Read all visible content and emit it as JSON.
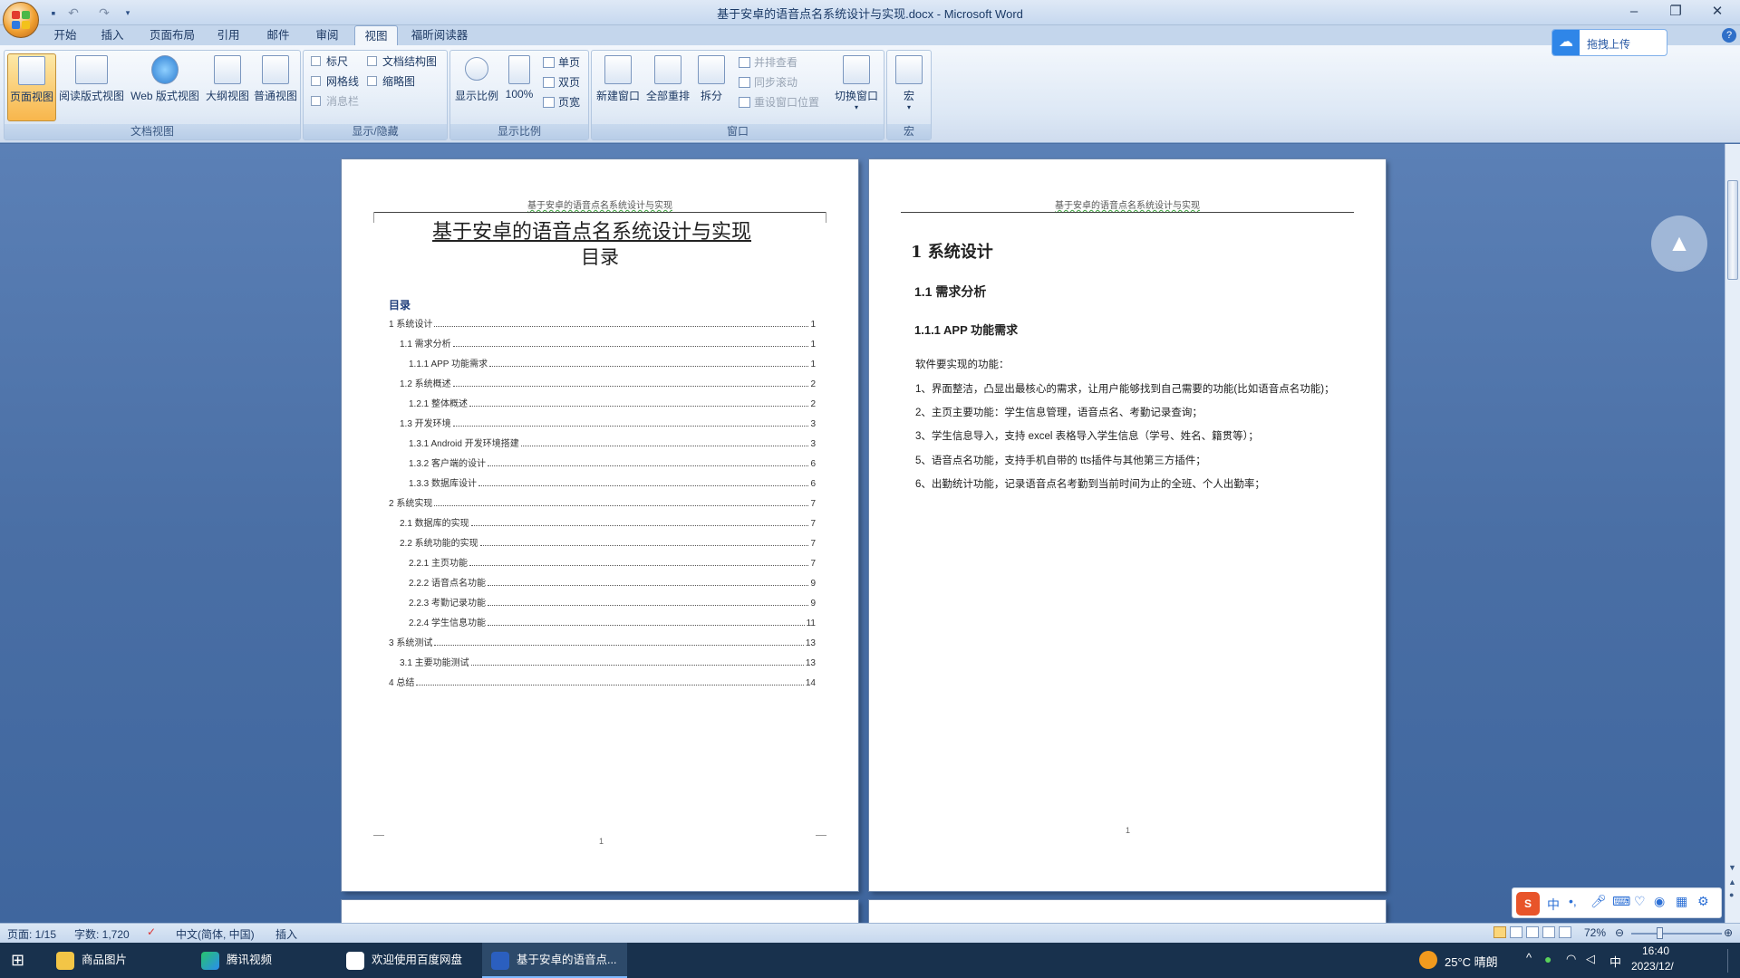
{
  "window": {
    "title": "基于安卓的语音点名系统设计与实现.docx - Microsoft Word"
  },
  "tabs": [
    "开始",
    "插入",
    "页面布局",
    "引用",
    "邮件",
    "审阅",
    "视图",
    "福昕阅读器"
  ],
  "active_tab": "视图",
  "ribbon": {
    "doc_views": {
      "label": "文档视图",
      "buttons": [
        "页面视图",
        "阅读版式视图",
        "Web 版式视图",
        "大纲视图",
        "普通视图"
      ]
    },
    "show_hide": {
      "label": "显示/隐藏",
      "checks": [
        "标尺",
        "网格线",
        "消息栏",
        "文档结构图",
        "缩略图"
      ]
    },
    "zoom": {
      "label": "显示比例",
      "zoom_btn": "显示比例",
      "pct_btn": "100%",
      "single": "单页",
      "double": "双页",
      "width": "页宽"
    },
    "window": {
      "label": "窗口",
      "new": "新建窗口",
      "arrange": "全部重排",
      "split": "拆分",
      "side": "并排查看",
      "sync": "同步滚动",
      "reset": "重设窗口位置",
      "switch": "切换窗口"
    },
    "macro": {
      "label": "宏",
      "btn": "宏"
    }
  },
  "baidu": {
    "upload": "拖拽上传"
  },
  "page1": {
    "header": "基于安卓的语音点名系统设计与实现",
    "title": "基于安卓的语音点名系统设计与实现",
    "subtitle": "目录",
    "toc_heading": "目录",
    "toc": [
      {
        "text": "1 系统设计",
        "page": "1"
      },
      {
        "text": "1.1 需求分析",
        "page": "1"
      },
      {
        "text": "1.1.1 APP 功能需求",
        "page": "1"
      },
      {
        "text": "1.2 系统概述",
        "page": "2"
      },
      {
        "text": "1.2.1 整体概述",
        "page": "2"
      },
      {
        "text": "1.3 开发环境",
        "page": "3"
      },
      {
        "text": "1.3.1 Android 开发环境搭建",
        "page": "3"
      },
      {
        "text": "1.3.2 客户端的设计",
        "page": "6"
      },
      {
        "text": "1.3.3 数据库设计",
        "page": "6"
      },
      {
        "text": "2 系统实现",
        "page": "7"
      },
      {
        "text": "2.1 数据库的实现",
        "page": "7"
      },
      {
        "text": "2.2 系统功能的实现",
        "page": "7"
      },
      {
        "text": "2.2.1 主页功能",
        "page": "7"
      },
      {
        "text": "2.2.2 语音点名功能",
        "page": "9"
      },
      {
        "text": "2.2.3 考勤记录功能",
        "page": "9"
      },
      {
        "text": "2.2.4 学生信息功能",
        "page": "11"
      },
      {
        "text": "3 系统测试",
        "page": "13"
      },
      {
        "text": "3.1 主要功能测试",
        "page": "13"
      },
      {
        "text": "4 总结",
        "page": "14"
      }
    ]
  },
  "page2": {
    "header": "基于安卓的语音点名系统设计与实现",
    "h1": "1  系统设计",
    "h2": "1.1  需求分析",
    "h3": "1.1.1  APP 功能需求",
    "intro": "软件要实现的功能：",
    "items": [
      "1、界面整洁，凸显出最核心的需求，让用户能够找到自己需要的功能(比如语音点名功能)；",
      "2、主页主要功能：学生信息管理，语音点名、考勤记录查询；",
      "3、学生信息导入，支持 excel 表格导入学生信息（学号、姓名、籍贯等）；",
      "5、语音点名功能，支持手机自带的 tts插件与其他第三方插件；",
      "6、出勤统计功能，记录语音点名考勤到当前时间为止的全班、个人出勤率；"
    ],
    "footer_page": "1"
  },
  "status": {
    "page": "页面: 1/15",
    "words": "字数: 1,720",
    "lang": "中文(简体, 中国)",
    "mode": "插入",
    "zoom": "72%"
  },
  "taskbar": {
    "items": [
      "商品图片",
      "腾讯视频",
      "欢迎使用百度网盘",
      "基于安卓的语音点..."
    ],
    "weather": "25°C 晴朗",
    "ime": "中",
    "time": "16:40",
    "date": "2023/12/"
  },
  "colors": {
    "accent": "#2b5797",
    "ribbon_bg": "#dde8f5",
    "workspace": "#4a6fa5",
    "taskbar": "#18314d"
  }
}
